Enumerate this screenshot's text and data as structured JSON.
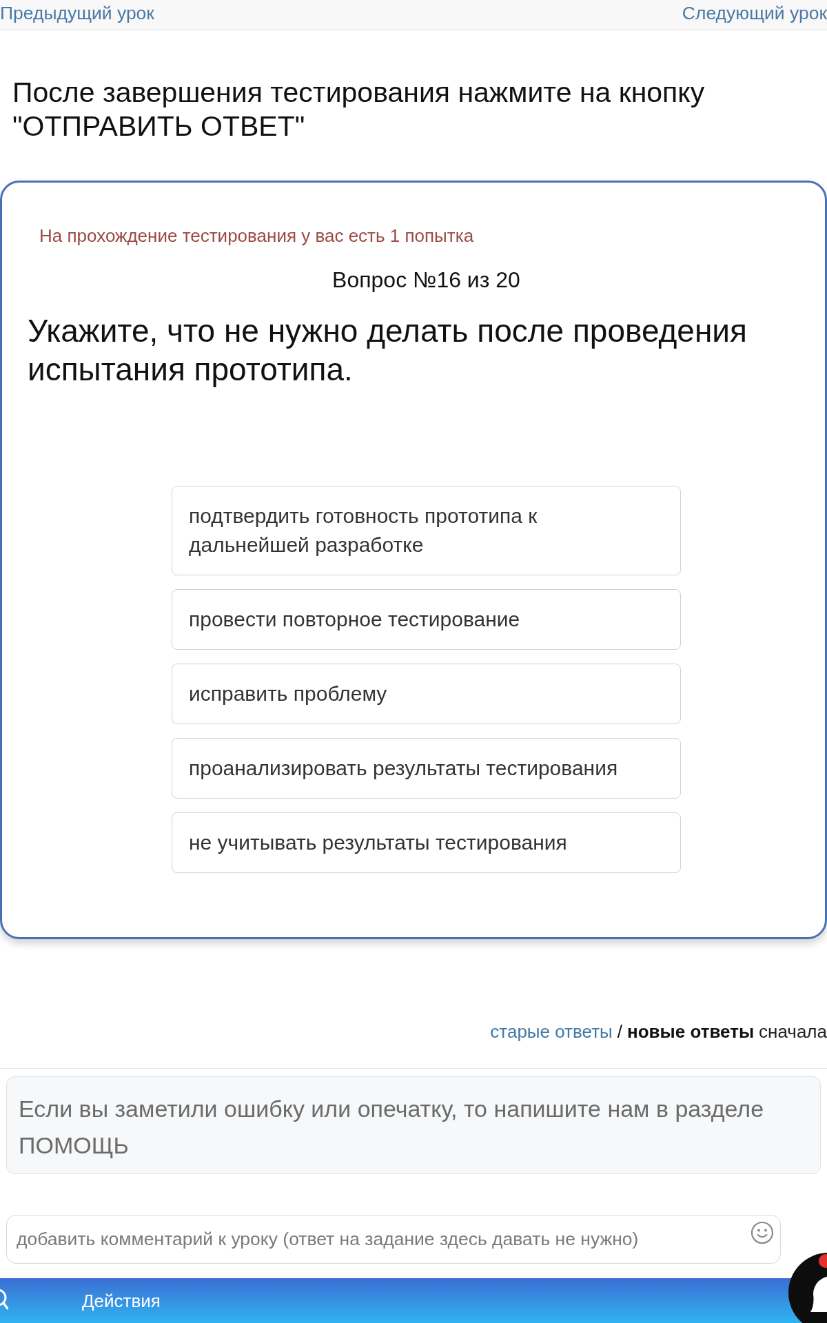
{
  "nav": {
    "previous": "Предыдущий урок",
    "next": "Следующий урок"
  },
  "instruction": "После завершения тестирования нажмите на кнопку \"ОТПРАВИТЬ ОТВЕТ\"",
  "quiz": {
    "attempts_note": "На прохождение тестирования у вас есть 1 попытка",
    "counter": "Вопрос №16 из 20",
    "question": "Укажите, что не нужно делать после проведения испытания прототипа.",
    "options": [
      {
        "label": "подтвердить готовность прототипа к дальнейшей разработке",
        "selected": false
      },
      {
        "label": "провести повторное тестирование",
        "selected": false
      },
      {
        "label": "исправить проблему",
        "selected": false
      },
      {
        "label": "проанализировать результаты тестирования",
        "selected": false
      },
      {
        "label": "не учитывать результаты тестирования",
        "selected": false
      }
    ]
  },
  "comments_sort": {
    "options": [
      {
        "label": "старые ответы",
        "selected": false
      },
      {
        "label": "новые ответы",
        "selected": true
      }
    ],
    "separator": "/",
    "suffix": "сначала"
  },
  "help_notice": "Если вы заметили ошибку или опечатку, то напишите нам в разделе ПОМОЩЬ",
  "comment_field": {
    "placeholder": "добавить комментарий к уроку (ответ на задание здесь давать не нужно)"
  },
  "bottom_bar": {
    "label": "Действия"
  }
}
